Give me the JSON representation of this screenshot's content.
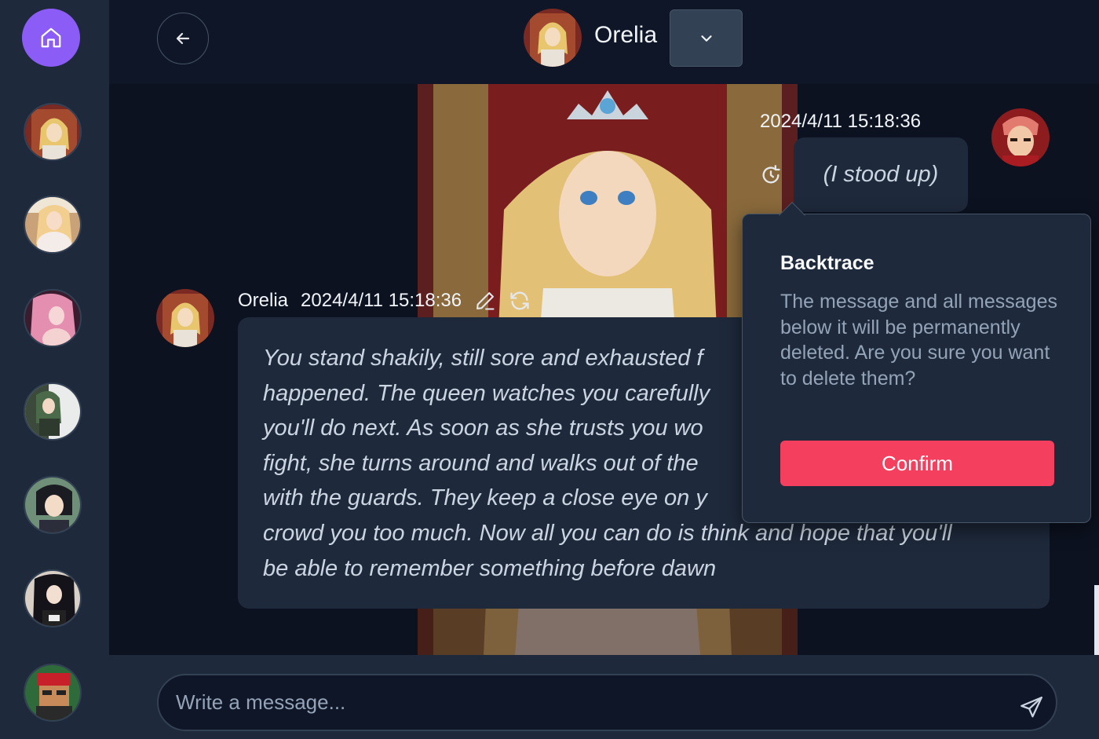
{
  "sidebar": {
    "home_icon": "home-icon",
    "characters": [
      {
        "icon": "character-avatar"
      },
      {
        "icon": "character-avatar"
      },
      {
        "icon": "character-avatar"
      },
      {
        "icon": "character-avatar"
      },
      {
        "icon": "character-avatar"
      },
      {
        "icon": "character-avatar"
      },
      {
        "icon": "character-avatar"
      }
    ]
  },
  "header": {
    "back_icon": "arrow-left-icon",
    "character_name": "Orelia",
    "dropdown_icon": "chevron-down-icon"
  },
  "messages": {
    "user": {
      "timestamp": "2024/4/11 15:18:36",
      "text": "(I stood up)"
    },
    "bot": {
      "name": "Orelia",
      "timestamp": "2024/4/11 15:18:36",
      "lines": [
        "You stand shakily, still sore and exhausted f",
        "happened. The queen watches you carefully",
        "you'll do next. As soon as she trusts you wo",
        "fight, she turns around and walks out of the",
        "with the guards. They keep a close eye on y",
        "crowd you too much. Now all you can do is think and hope that you'll",
        "be able to remember something before dawn"
      ]
    }
  },
  "popover": {
    "title": "Backtrace",
    "body": "The message and all messages below it will be permanently deleted. Are you sure you want to delete them?",
    "confirm_label": "Confirm"
  },
  "composer": {
    "placeholder": "Write a message...",
    "send_icon": "send-icon"
  },
  "colors": {
    "accent": "#8b5cf6",
    "danger": "#f43f5e",
    "panel": "#1e293b",
    "background": "#0f1628"
  }
}
